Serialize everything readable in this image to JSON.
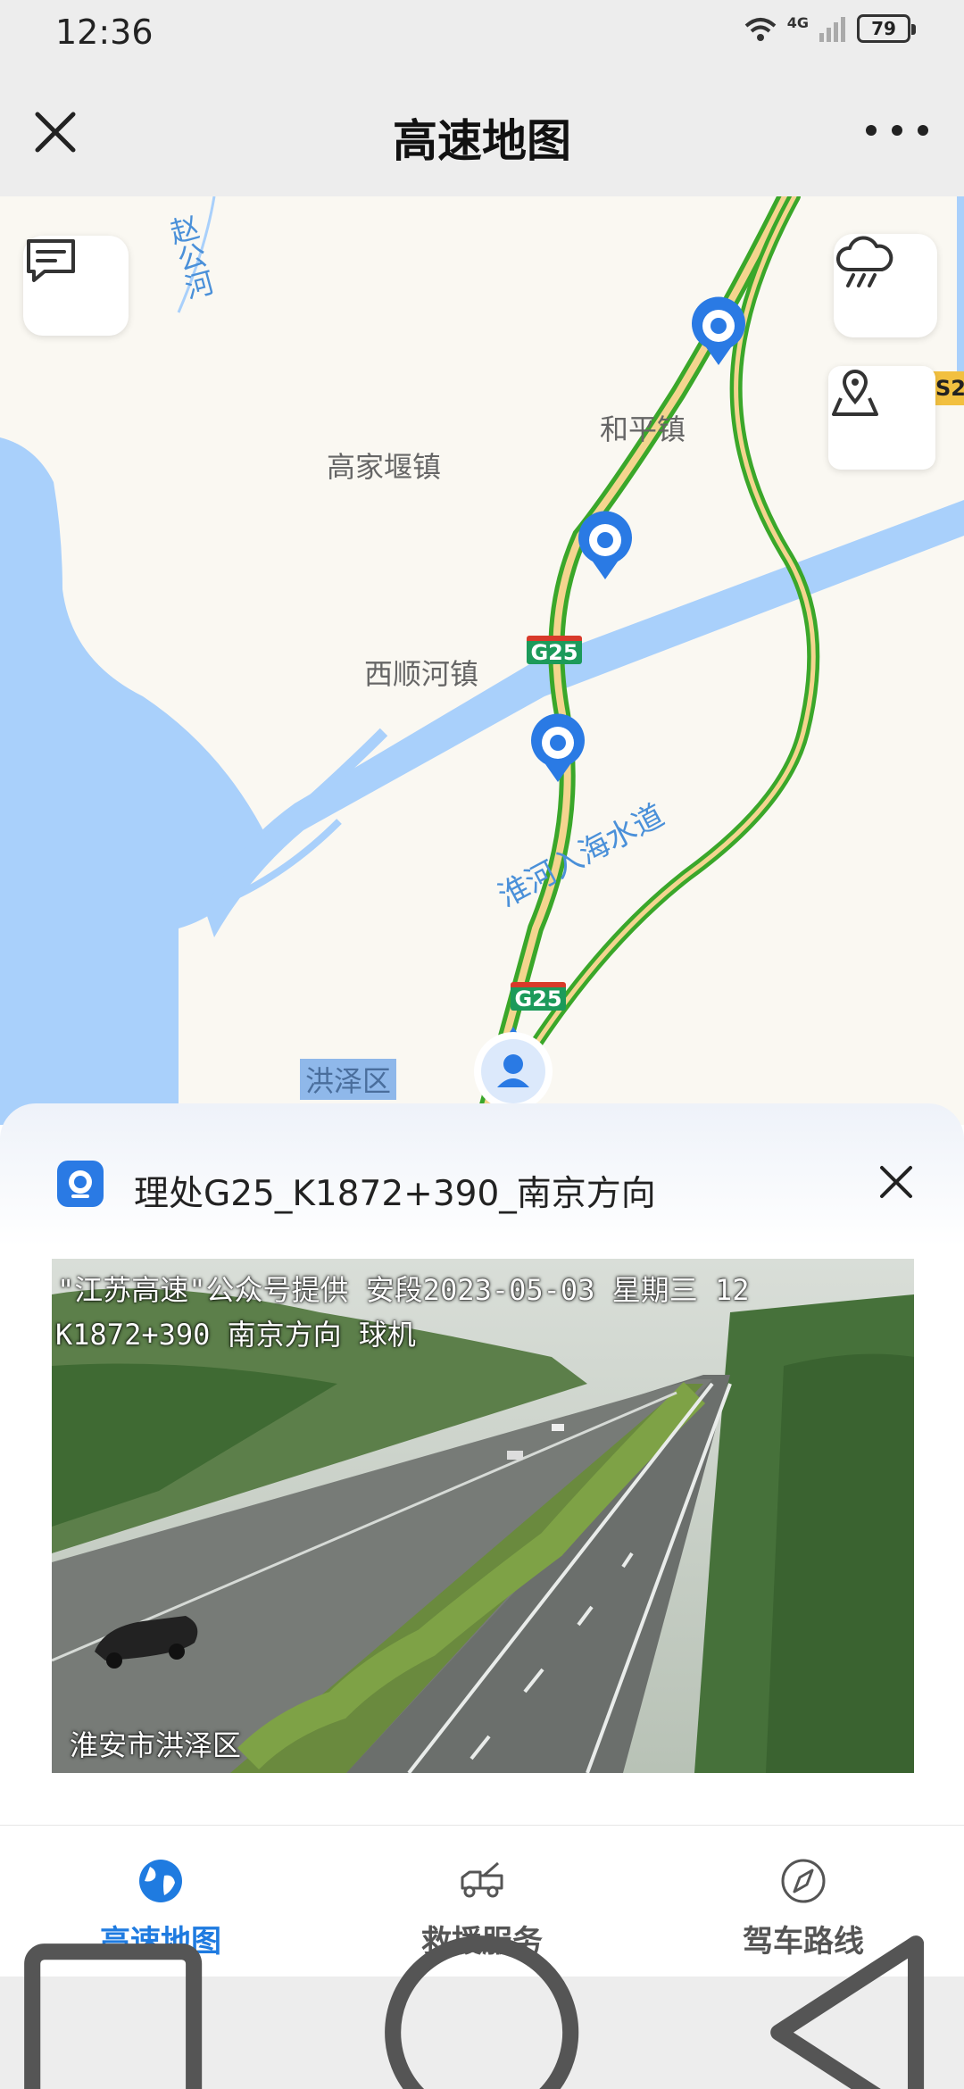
{
  "status_bar": {
    "time": "12:36",
    "network": "4G",
    "battery": "79"
  },
  "navbar": {
    "title": "高速地图"
  },
  "map": {
    "labels": {
      "river": "赵公河",
      "town1": "和平镇",
      "town2": "高家堰镇",
      "town3": "西顺河镇",
      "waterway": "淮河入海水道",
      "district": "洪泽区",
      "road_shield": "G25",
      "edge_shield": "S2"
    }
  },
  "camera_sheet": {
    "title": "理处G25_K1872+390_南京方向",
    "overlay_line1": "\"江苏高速\"公众号提供 安段2023-05-03 星期三 12",
    "overlay_line2": "K1872+390   南京方向 球机",
    "overlay_bottom": "淮安市洪泽区"
  },
  "tabs": [
    {
      "label": "高速地图",
      "active": true
    },
    {
      "label": "救援服务",
      "active": false
    },
    {
      "label": "驾车路线",
      "active": false
    }
  ],
  "colors": {
    "accent": "#1f7be0",
    "road_green": "#3aa72a",
    "road_fill": "#f4d58f",
    "water": "#a9d0fb"
  }
}
